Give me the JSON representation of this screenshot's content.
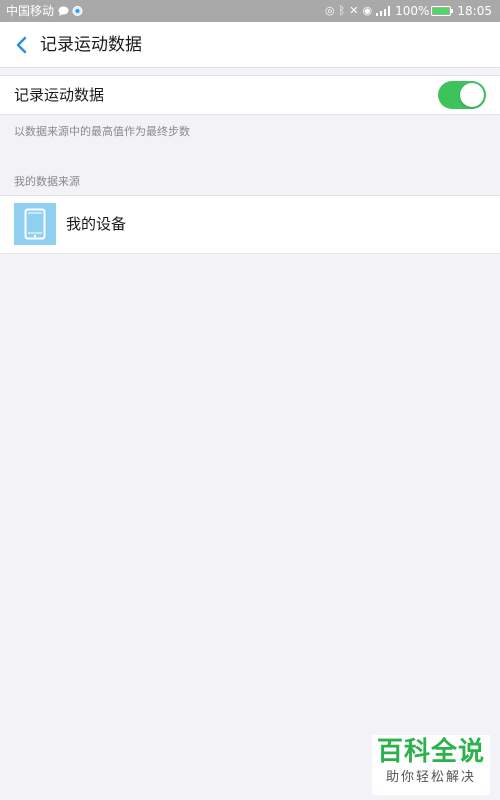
{
  "status_bar": {
    "carrier": "中国移动",
    "battery": "100%",
    "time": "18:05",
    "left_icons": [
      "chat-bubble-icon",
      "app-badge-icon"
    ],
    "right_icons": [
      "nfc-icon",
      "bluetooth-icon",
      "mute-icon",
      "eye-icon",
      "signal-icon"
    ]
  },
  "header": {
    "title": "记录运动数据"
  },
  "toggle": {
    "label": "记录运动数据",
    "on": true,
    "color": "#3ec25a"
  },
  "hint": "以数据来源中的最高值作为最终步数",
  "sources": {
    "section_title": "我的数据来源",
    "items": [
      {
        "label": "我的设备",
        "icon": "tablet-icon"
      }
    ]
  },
  "watermark": {
    "title": "百科全说",
    "subtitle": "助你轻松解决"
  },
  "colors": {
    "accent": "#2b8fe0",
    "background": "#f2f2f7",
    "status_bar": "#a9a9a9",
    "device_icon_bg": "#8fd0f0"
  }
}
